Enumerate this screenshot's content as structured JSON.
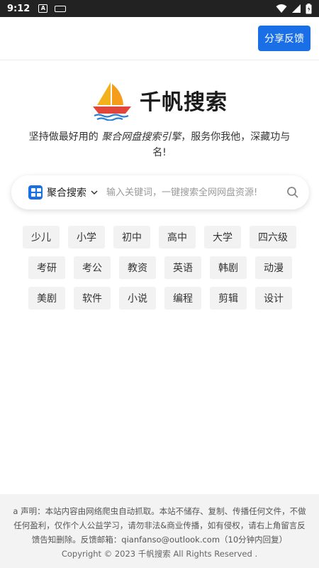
{
  "status_bar": {
    "time": "9:12",
    "app_icon": "A"
  },
  "header": {
    "share_button_label": "分享反馈"
  },
  "logo": {
    "title": "千帆搜索"
  },
  "tagline": {
    "before": "坚持做最好用的 ",
    "highlight": "聚合网盘搜索引擎",
    "after": "，服务你我他，深藏功与名!"
  },
  "search": {
    "engine_label": "聚合搜索",
    "placeholder": "输入关键词，一键搜索全网网盘资源!"
  },
  "tags": [
    [
      "少儿",
      "小学",
      "初中",
      "高中",
      "大学",
      "四六级"
    ],
    [
      "考研",
      "考公",
      "教资",
      "英语",
      "韩剧",
      "动漫"
    ],
    [
      "美剧",
      "软件",
      "小说",
      "编程",
      "剪辑",
      "设计"
    ]
  ],
  "footer": {
    "disclaimer": "a 声明：本站内容由网络爬虫自动抓取。本站不储存、复制、传播任何文件，不做任何盈利，仅作个人公益学习，请勿非法&商业传播，如有侵权，请右上角留言反馈告知删除。反馈邮箱：qianfanso@outlook.com（10分钟内回复）",
    "copyright": "Copyright © 2023 千帆搜索 All Rights Reserved ."
  },
  "colors": {
    "accent": "#1a6ee6",
    "status_bar": "#222222"
  }
}
